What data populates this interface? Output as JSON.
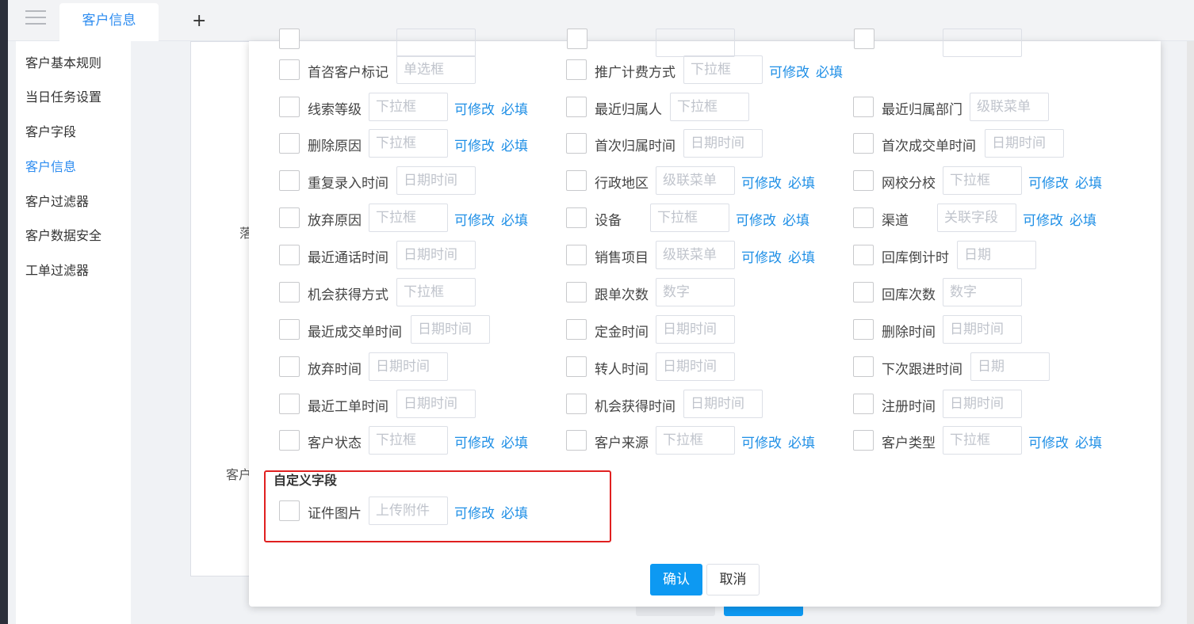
{
  "tabs": {
    "active_label": "客户信息",
    "add_label": "+"
  },
  "sidebar": {
    "items": [
      {
        "label": "客户基本规则"
      },
      {
        "label": "当日任务设置"
      },
      {
        "label": "客户字段"
      },
      {
        "label": "客户信息"
      },
      {
        "label": "客户过滤器"
      },
      {
        "label": "客户数据安全"
      },
      {
        "label": "工单过滤器"
      }
    ]
  },
  "background": {
    "label_a": "落",
    "label_b": "客户"
  },
  "modal": {
    "rows": [
      [
        {
          "label": "首咨客户标记",
          "placeholder": "单选框",
          "editable": "",
          "required": ""
        },
        {
          "label": "推广计费方式",
          "placeholder": "下拉框",
          "editable": "可修改",
          "required": "必填"
        },
        {
          "label": "",
          "placeholder": "",
          "editable": "",
          "required": ""
        }
      ],
      [
        {
          "label": "线索等级",
          "placeholder": "下拉框",
          "editable": "可修改",
          "required": "必填"
        },
        {
          "label": "最近归属人",
          "placeholder": "下拉框",
          "editable": "",
          "required": ""
        },
        {
          "label": "最近归属部门",
          "placeholder": "级联菜单",
          "editable": "",
          "required": ""
        }
      ],
      [
        {
          "label": "删除原因",
          "placeholder": "下拉框",
          "editable": "可修改",
          "required": "必填"
        },
        {
          "label": "首次归属时间",
          "placeholder": "日期时间",
          "editable": "",
          "required": ""
        },
        {
          "label": "首次成交单时间",
          "placeholder": "日期时间",
          "editable": "",
          "required": ""
        }
      ],
      [
        {
          "label": "重复录入时间",
          "placeholder": "日期时间",
          "editable": "",
          "required": ""
        },
        {
          "label": "行政地区",
          "placeholder": "级联菜单",
          "editable": "可修改",
          "required": "必填"
        },
        {
          "label": "网校分校",
          "placeholder": "下拉框",
          "editable": "可修改",
          "required": "必填"
        }
      ],
      [
        {
          "label": "放弃原因",
          "placeholder": "下拉框",
          "editable": "可修改",
          "required": "必填"
        },
        {
          "label": "设备",
          "placeholder": "下拉框",
          "editable": "可修改",
          "required": "必填"
        },
        {
          "label": "渠道",
          "placeholder": "关联字段",
          "editable": "可修改",
          "required": "必填"
        }
      ],
      [
        {
          "label": "最近通话时间",
          "placeholder": "日期时间",
          "editable": "",
          "required": ""
        },
        {
          "label": "销售项目",
          "placeholder": "级联菜单",
          "editable": "可修改",
          "required": "必填"
        },
        {
          "label": "回库倒计时",
          "placeholder": "日期",
          "editable": "",
          "required": ""
        }
      ],
      [
        {
          "label": "机会获得方式",
          "placeholder": "下拉框",
          "editable": "",
          "required": ""
        },
        {
          "label": "跟单次数",
          "placeholder": "数字",
          "editable": "",
          "required": ""
        },
        {
          "label": "回库次数",
          "placeholder": "数字",
          "editable": "",
          "required": ""
        }
      ],
      [
        {
          "label": "最近成交单时间",
          "placeholder": "日期时间",
          "editable": "",
          "required": ""
        },
        {
          "label": "定金时间",
          "placeholder": "日期时间",
          "editable": "",
          "required": ""
        },
        {
          "label": "删除时间",
          "placeholder": "日期时间",
          "editable": "",
          "required": ""
        }
      ],
      [
        {
          "label": "放弃时间",
          "placeholder": "日期时间",
          "editable": "",
          "required": ""
        },
        {
          "label": "转人时间",
          "placeholder": "日期时间",
          "editable": "",
          "required": ""
        },
        {
          "label": "下次跟进时间",
          "placeholder": "日期",
          "editable": "",
          "required": ""
        }
      ],
      [
        {
          "label": "最近工单时间",
          "placeholder": "日期时间",
          "editable": "",
          "required": ""
        },
        {
          "label": "机会获得时间",
          "placeholder": "日期时间",
          "editable": "",
          "required": ""
        },
        {
          "label": "注册时间",
          "placeholder": "日期时间",
          "editable": "",
          "required": ""
        }
      ],
      [
        {
          "label": "客户状态",
          "placeholder": "下拉框",
          "editable": "可修改",
          "required": "必填"
        },
        {
          "label": "客户来源",
          "placeholder": "下拉框",
          "editable": "可修改",
          "required": "必填"
        },
        {
          "label": "客户类型",
          "placeholder": "下拉框",
          "editable": "可修改",
          "required": "必填"
        }
      ]
    ],
    "custom_section": {
      "title": "自定义字段",
      "field": {
        "label": "证件图片",
        "placeholder": "上传附件",
        "editable": "可修改",
        "required": "必填"
      }
    },
    "buttons": {
      "confirm": "确认",
      "cancel": "取消"
    }
  },
  "colors": {
    "accent": "#0d99f2",
    "link": "#1f8fe6",
    "highlight_border": "#e02020"
  }
}
